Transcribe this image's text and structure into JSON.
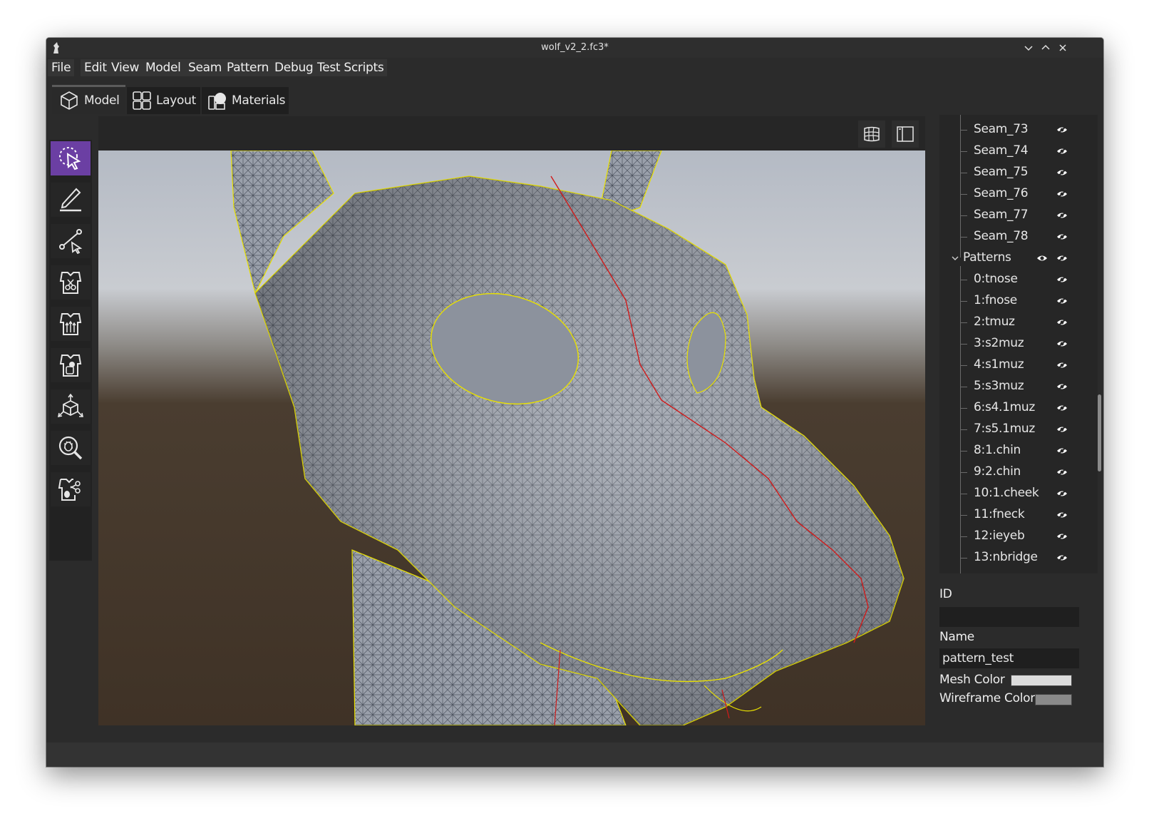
{
  "window": {
    "title": "wolf_v2_2.fc3*"
  },
  "menu": [
    "File",
    "Edit",
    "View",
    "Model",
    "Seam",
    "Pattern",
    "Debug",
    "Test Scripts"
  ],
  "tabs": [
    {
      "label": "Model",
      "icon": "cube-icon",
      "active": true
    },
    {
      "label": "Layout",
      "icon": "grid-layout-icon",
      "active": false
    },
    {
      "label": "Materials",
      "icon": "materials-icon",
      "active": false
    }
  ],
  "tools": [
    {
      "name": "select-tool",
      "icon": "select-cursor-icon",
      "active": true
    },
    {
      "name": "draw-tool",
      "icon": "pen-icon",
      "active": false
    },
    {
      "name": "seam-path-tool",
      "icon": "path-select-icon",
      "active": false
    },
    {
      "name": "pattern-cut-tool",
      "icon": "pattern-scissors-icon",
      "active": false
    },
    {
      "name": "pattern-arrange-tool",
      "icon": "pattern-arrows-icon",
      "active": false
    },
    {
      "name": "pattern-fill-tool",
      "icon": "pattern-bucket-icon",
      "active": false
    },
    {
      "name": "transform-tool",
      "icon": "transform-cube-icon",
      "active": false
    },
    {
      "name": "debug-inspect-tool",
      "icon": "bug-magnifier-icon",
      "active": false
    },
    {
      "name": "pattern-debug-tool",
      "icon": "pattern-bug-icon",
      "active": false
    }
  ],
  "viewport_buttons": [
    {
      "name": "wireframe-toggle",
      "icon": "wireframe-icon"
    },
    {
      "name": "panel-toggle",
      "icon": "sidebar-icon"
    }
  ],
  "tree": {
    "seams": [
      "Seam_73",
      "Seam_74",
      "Seam_75",
      "Seam_76",
      "Seam_77",
      "Seam_78"
    ],
    "patterns_label": "Patterns",
    "patterns": [
      "0:tnose",
      "1:fnose",
      "2:tmuz",
      "3:s2muz",
      "4:s1muz",
      "5:s3muz",
      "6:s4.1muz",
      "7:s5.1muz",
      "8:1.chin",
      "9:2.chin",
      "10:1.cheek",
      "11:fneck",
      "12:ieyeb",
      "13:nbridge"
    ]
  },
  "properties": {
    "id_label": "ID",
    "id_value": "",
    "name_label": "Name",
    "name_value": "pattern_test",
    "mesh_color_label": "Mesh Color",
    "mesh_color": "#dcdcdc",
    "wireframe_color_label": "Wireframe Color",
    "wireframe_color": "#8a8a8a"
  },
  "colors": {
    "accent": "#6b3fa3",
    "seam_line": "#d11a1a",
    "outline": "#e8e000",
    "sky_top": "#b4bac4",
    "ground": "#3f3226"
  }
}
